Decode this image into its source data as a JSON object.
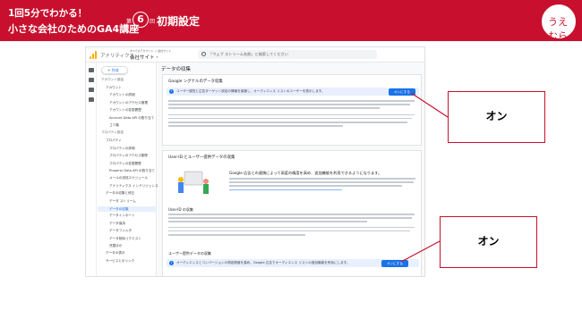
{
  "header": {
    "line1": "1回5分でわかる！",
    "line2": "小さな会社のためのGA4講座",
    "episode_prefix": "第",
    "episode_number": "6",
    "episode_suffix": "回",
    "episode_title": "初期設定",
    "logo_text": "うえむら",
    "color": "#c8102e"
  },
  "app": {
    "name": "アナリティクス",
    "account_small": "すべてのアカウント > 会社サイト",
    "account": "会社サイト・",
    "search_placeholder": "「ウェブ ストリーム名前」と検索してください",
    "create_label": "+ 作成",
    "nav": [
      {
        "label": "アカウント設定",
        "kind": "sec"
      },
      {
        "label": "アカウント",
        "kind": "l2"
      },
      {
        "label": "アカウントの詳細",
        "kind": "l3"
      },
      {
        "label": "アカウントのアクセス管理",
        "kind": "l3"
      },
      {
        "label": "アカウントの変更履歴",
        "kind": "l3"
      },
      {
        "label": "Account Data API の割り当て",
        "kind": "l3"
      },
      {
        "label": "ゴミ箱",
        "kind": "l3"
      },
      {
        "label": "プロパティ設定",
        "kind": "sec"
      },
      {
        "label": "プロパティ",
        "kind": "l2"
      },
      {
        "label": "プロパティの詳細",
        "kind": "l3"
      },
      {
        "label": "プロパティのアクセス管理",
        "kind": "l3"
      },
      {
        "label": "プロパティの変更履歴",
        "kind": "l3"
      },
      {
        "label": "Property Data API の割り当て",
        "kind": "l3"
      },
      {
        "label": "メールの送信スケジュール",
        "kind": "l3"
      },
      {
        "label": "アナリティクス インテリジェンス",
        "kind": "l3"
      },
      {
        "label": "データの収集と修正",
        "kind": "l2"
      },
      {
        "label": "データ ストリーム",
        "kind": "l3"
      },
      {
        "label": "データの収集",
        "kind": "active"
      },
      {
        "label": "データインポート",
        "kind": "l3"
      },
      {
        "label": "データ保持",
        "kind": "l3"
      },
      {
        "label": "データフィルタ",
        "kind": "l3"
      },
      {
        "label": "データ削除リクエスト",
        "kind": "l3"
      },
      {
        "label": "児童ほか",
        "kind": "l3"
      },
      {
        "label": "データの表示",
        "kind": "l2"
      },
      {
        "label": "サービスとのリンク",
        "kind": "l2"
      }
    ],
    "page_title": "データの収集",
    "google_signals": {
      "heading": "Google シグナルのデータ収集",
      "notice": "ユーザー属性と広告ターゲット設定の情報を保管し、オーディエンス リストのユーザーを表示します。",
      "button": "オンにする"
    },
    "user_id": {
      "heading": "User-ID とユーザー提供データの収集",
      "promo": "Google 広告との連携によって高度の精度を高め、追加機能を利用できるようになります。",
      "section1": "User-ID の収集",
      "section2": "ユーザー提供データの収集",
      "notice": "オーディエンスとコンバージョンの測定精度を高め、Google 広告でオーディエンス リストの追加機能を有効にします。",
      "button": "オンにする"
    }
  },
  "callouts": [
    {
      "label": "オン"
    },
    {
      "label": "オン"
    }
  ]
}
